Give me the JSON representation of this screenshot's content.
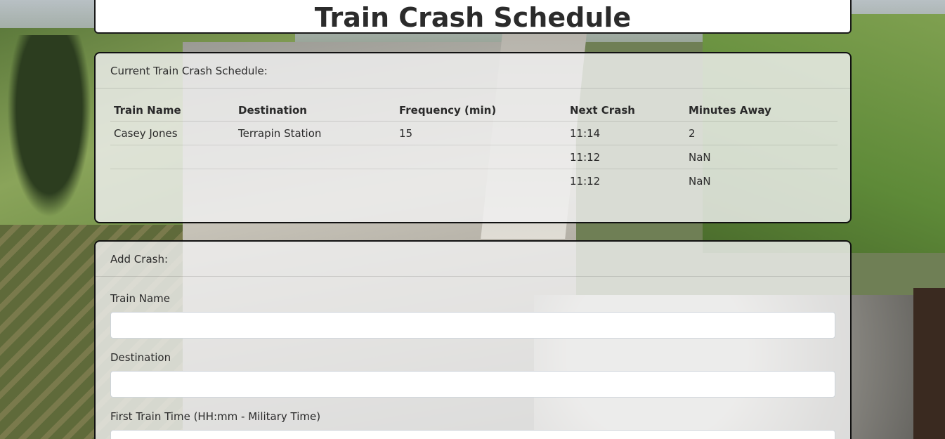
{
  "page_title": "Train Crash Schedule",
  "schedule": {
    "header": "Current Train Crash Schedule:",
    "columns": [
      "Train Name",
      "Destination",
      "Frequency (min)",
      "Next Crash",
      "Minutes Away"
    ],
    "rows": [
      [
        "Casey Jones",
        "Terrapin Station",
        "15",
        "11:14",
        "2"
      ],
      [
        "",
        "",
        "",
        "11:12",
        "NaN"
      ],
      [
        "",
        "",
        "",
        "11:12",
        "NaN"
      ]
    ]
  },
  "add_crash": {
    "header": "Add Crash:",
    "fields": [
      {
        "label": "Train Name",
        "value": ""
      },
      {
        "label": "Destination",
        "value": ""
      },
      {
        "label": "First Train Time (HH:mm - Military Time)",
        "value": ""
      }
    ]
  }
}
